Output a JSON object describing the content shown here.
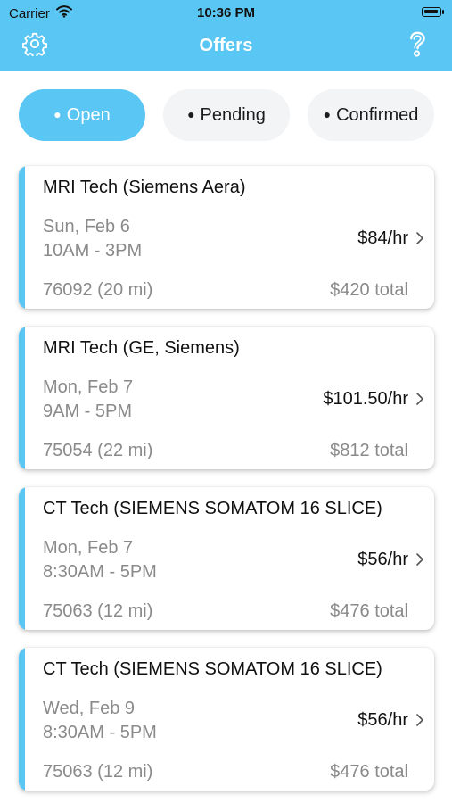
{
  "status": {
    "carrier": "Carrier",
    "time": "10:36 PM",
    "wifi_icon": "wifi-icon",
    "battery_icon": "battery-icon"
  },
  "header": {
    "title": "Offers",
    "left_icon": "gear-icon",
    "right_icon": "help-icon"
  },
  "tabs": [
    {
      "label": "Open",
      "active": true
    },
    {
      "label": "Pending",
      "active": false
    },
    {
      "label": "Confirmed",
      "active": false
    }
  ],
  "offers": [
    {
      "title": "MRI Tech (Siemens Aera)",
      "date": "Sun, Feb 6",
      "time": "10AM - 3PM",
      "rate": "$84/hr",
      "location": "76092 (20 mi)",
      "total": "$420 total"
    },
    {
      "title": "MRI Tech (GE, Siemens)",
      "date": "Mon, Feb 7",
      "time": "9AM - 5PM",
      "rate": "$101.50/hr",
      "location": "75054 (22 mi)",
      "total": "$812 total"
    },
    {
      "title": "CT Tech (SIEMENS SOMATOM 16 SLICE)",
      "date": "Mon, Feb 7",
      "time": "8:30AM - 5PM",
      "rate": "$56/hr",
      "location": "75063 (12 mi)",
      "total": "$476 total"
    },
    {
      "title": "CT Tech (SIEMENS SOMATOM 16 SLICE)",
      "date": "Wed, Feb 9",
      "time": "8:30AM - 5PM",
      "rate": "$56/hr",
      "location": "75063 (12 mi)",
      "total": "$476 total"
    }
  ],
  "colors": {
    "accent": "#5ac6f3",
    "inactive_tab": "#f3f4f6",
    "muted_text": "#8a8a8a"
  }
}
